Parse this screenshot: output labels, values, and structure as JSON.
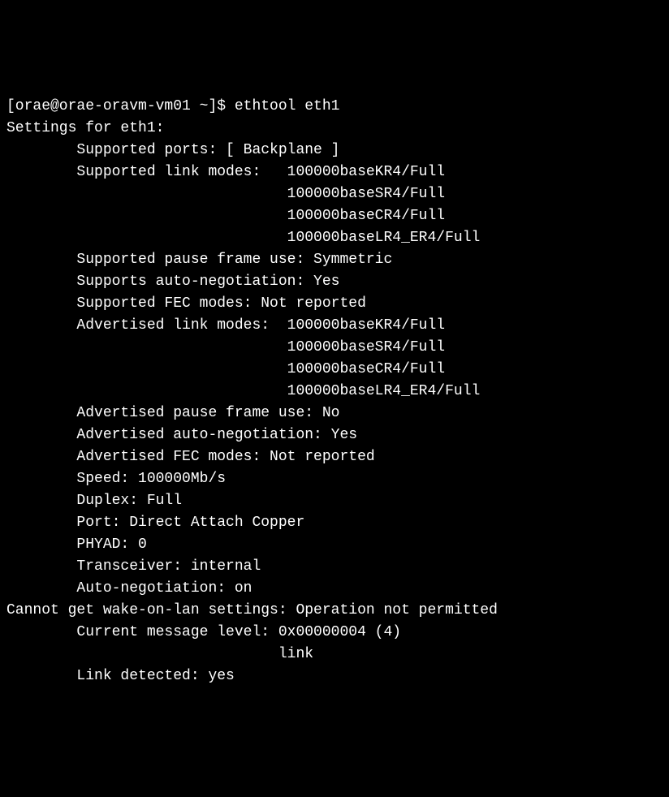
{
  "prompt": "[orae@orae-oravm-vm01 ~]$ ethtool eth1",
  "header": "Settings for eth1:",
  "lines": [
    "        Supported ports: [ Backplane ]",
    "        Supported link modes:   100000baseKR4/Full",
    "                                100000baseSR4/Full",
    "                                100000baseCR4/Full",
    "                                100000baseLR4_ER4/Full",
    "        Supported pause frame use: Symmetric",
    "        Supports auto-negotiation: Yes",
    "        Supported FEC modes: Not reported",
    "        Advertised link modes:  100000baseKR4/Full",
    "                                100000baseSR4/Full",
    "                                100000baseCR4/Full",
    "                                100000baseLR4_ER4/Full",
    "        Advertised pause frame use: No",
    "        Advertised auto-negotiation: Yes",
    "        Advertised FEC modes: Not reported",
    "        Speed: 100000Mb/s",
    "        Duplex: Full",
    "        Port: Direct Attach Copper",
    "        PHYAD: 0",
    "        Transceiver: internal",
    "        Auto-negotiation: on",
    "Cannot get wake-on-lan settings: Operation not permitted",
    "        Current message level: 0x00000004 (4)",
    "                               link",
    "        Link detected: yes"
  ]
}
